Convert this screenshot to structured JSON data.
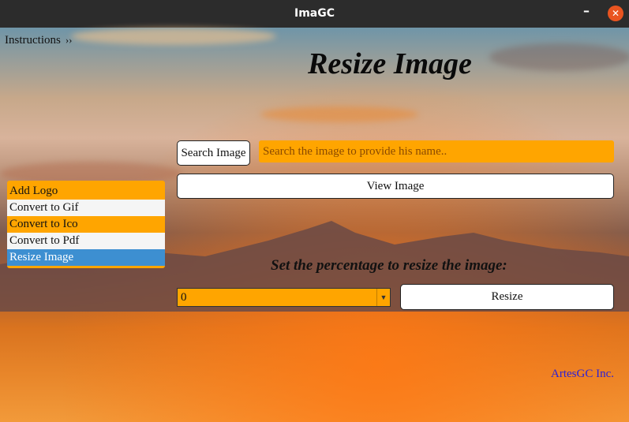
{
  "window": {
    "title": "ImaGC",
    "minimize_label": "–",
    "close_label": "✕"
  },
  "instructions": {
    "label": "Instructions",
    "chevron": "››"
  },
  "heading": "Resize Image",
  "search": {
    "button_label": "Search Image",
    "placeholder": "Search the image to provide his name.."
  },
  "view_button_label": "View Image",
  "menu": {
    "items": [
      {
        "label": "Add Logo"
      },
      {
        "label": "Convert to Gif"
      },
      {
        "label": "Convert to Ico"
      },
      {
        "label": "Convert to Pdf"
      },
      {
        "label": "Resize Image",
        "selected": true
      }
    ]
  },
  "percentage": {
    "prompt": "Set the percentage to resize the image:",
    "value": "0",
    "arrow": "▼"
  },
  "resize_button_label": "Resize",
  "footer": "ArtesGC Inc.",
  "colors": {
    "accent": "#ffa500",
    "selected": "#3d8fd1",
    "titlebar": "#2c2c2c",
    "close": "#e95420",
    "footer_link": "#2a1fd8"
  }
}
